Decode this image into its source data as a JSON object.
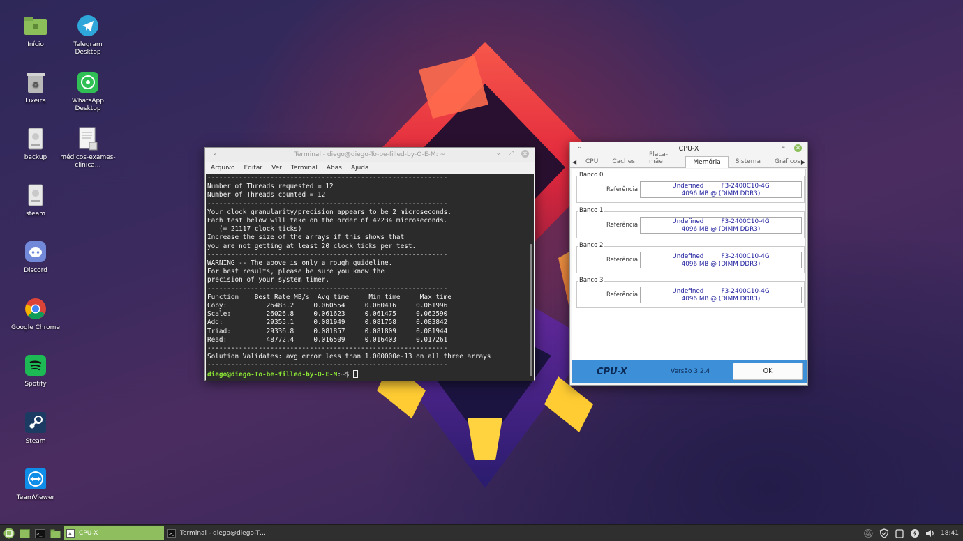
{
  "desktop": {
    "icons": [
      {
        "label": "Início",
        "icon": "home-folder-icon"
      },
      {
        "label": "Telegram Desktop",
        "icon": "telegram-icon"
      },
      {
        "label": "Lixeira",
        "icon": "trash-icon"
      },
      {
        "label": "WhatsApp Desktop",
        "icon": "whatsapp-icon"
      },
      {
        "label": "backup",
        "icon": "drive-icon"
      },
      {
        "label": "médicos-exames-clínica…",
        "icon": "document-icon"
      },
      {
        "label": "steam",
        "icon": "drive-icon"
      },
      {
        "label": "Discord",
        "icon": "discord-icon"
      },
      {
        "label": "Google Chrome",
        "icon": "chrome-icon"
      },
      {
        "label": "Spotify",
        "icon": "spotify-icon"
      },
      {
        "label": "Steam",
        "icon": "steam-icon"
      },
      {
        "label": "TeamViewer",
        "icon": "teamviewer-icon"
      }
    ]
  },
  "terminal": {
    "title": "Terminal - diego@diego-To-be-filled-by-O-E-M: ~",
    "menu": [
      "Arquivo",
      "Editar",
      "Ver",
      "Terminal",
      "Abas",
      "Ajuda"
    ],
    "lines": [
      "-------------------------------------------------------------",
      "Number of Threads requested = 12",
      "Number of Threads counted = 12",
      "-------------------------------------------------------------",
      "Your clock granularity/precision appears to be 2 microseconds.",
      "Each test below will take on the order of 42234 microseconds.",
      "   (= 21117 clock ticks)",
      "Increase the size of the arrays if this shows that",
      "you are not getting at least 20 clock ticks per test.",
      "-------------------------------------------------------------",
      "WARNING -- The above is only a rough guideline.",
      "For best results, please be sure you know the",
      "precision of your system timer.",
      "-------------------------------------------------------------",
      "Function    Best Rate MB/s  Avg time     Min time     Max time",
      "Copy:          26483.2     0.060554     0.060416     0.061996",
      "Scale:         26026.8     0.061623     0.061475     0.062590",
      "Add:           29355.1     0.081949     0.081758     0.083842",
      "Triad:         29336.8     0.081857     0.081809     0.081944",
      "Read:          48772.4     0.016509     0.016403     0.017261",
      "-------------------------------------------------------------",
      "Solution Validates: avg error less than 1.000000e-13 on all three arrays",
      "-------------------------------------------------------------"
    ],
    "prompt_user": "diego@diego-To-be-filled-by-O-E-M",
    "prompt_path": ":~$ "
  },
  "cpux": {
    "title": "CPU-X",
    "tabs": [
      "CPU",
      "Caches",
      "Placa-mãe",
      "Memória",
      "Sistema",
      "Gráficos"
    ],
    "active_tab": "Memória",
    "banks": [
      {
        "name": "Banco 0",
        "ref_label": "Referência",
        "line1_a": "Undefined",
        "line1_b": "F3-2400C10-4G",
        "line2": "4096 MB @ (DIMM DDR3)"
      },
      {
        "name": "Banco 1",
        "ref_label": "Referência",
        "line1_a": "Undefined",
        "line1_b": "F3-2400C10-4G",
        "line2": "4096 MB @ (DIMM DDR3)"
      },
      {
        "name": "Banco 2",
        "ref_label": "Referência",
        "line1_a": "Undefined",
        "line1_b": "F3-2400C10-4G",
        "line2": "4096 MB @ (DIMM DDR3)"
      },
      {
        "name": "Banco 3",
        "ref_label": "Referência",
        "line1_a": "Undefined",
        "line1_b": "F3-2400C10-4G",
        "line2": "4096 MB @ (DIMM DDR3)"
      }
    ],
    "footer_brand": "CPU-X",
    "version": "Versão 3.2.4",
    "ok_label": "OK"
  },
  "taskbar": {
    "tasks": [
      {
        "label": "CPU-X",
        "active": true
      },
      {
        "label": "Terminal - diego@diego-T…",
        "active": false
      }
    ],
    "clock": "18:41",
    "colors": {
      "active_task": "#8fbe5e",
      "menu_button": "#8fbe5e"
    }
  }
}
